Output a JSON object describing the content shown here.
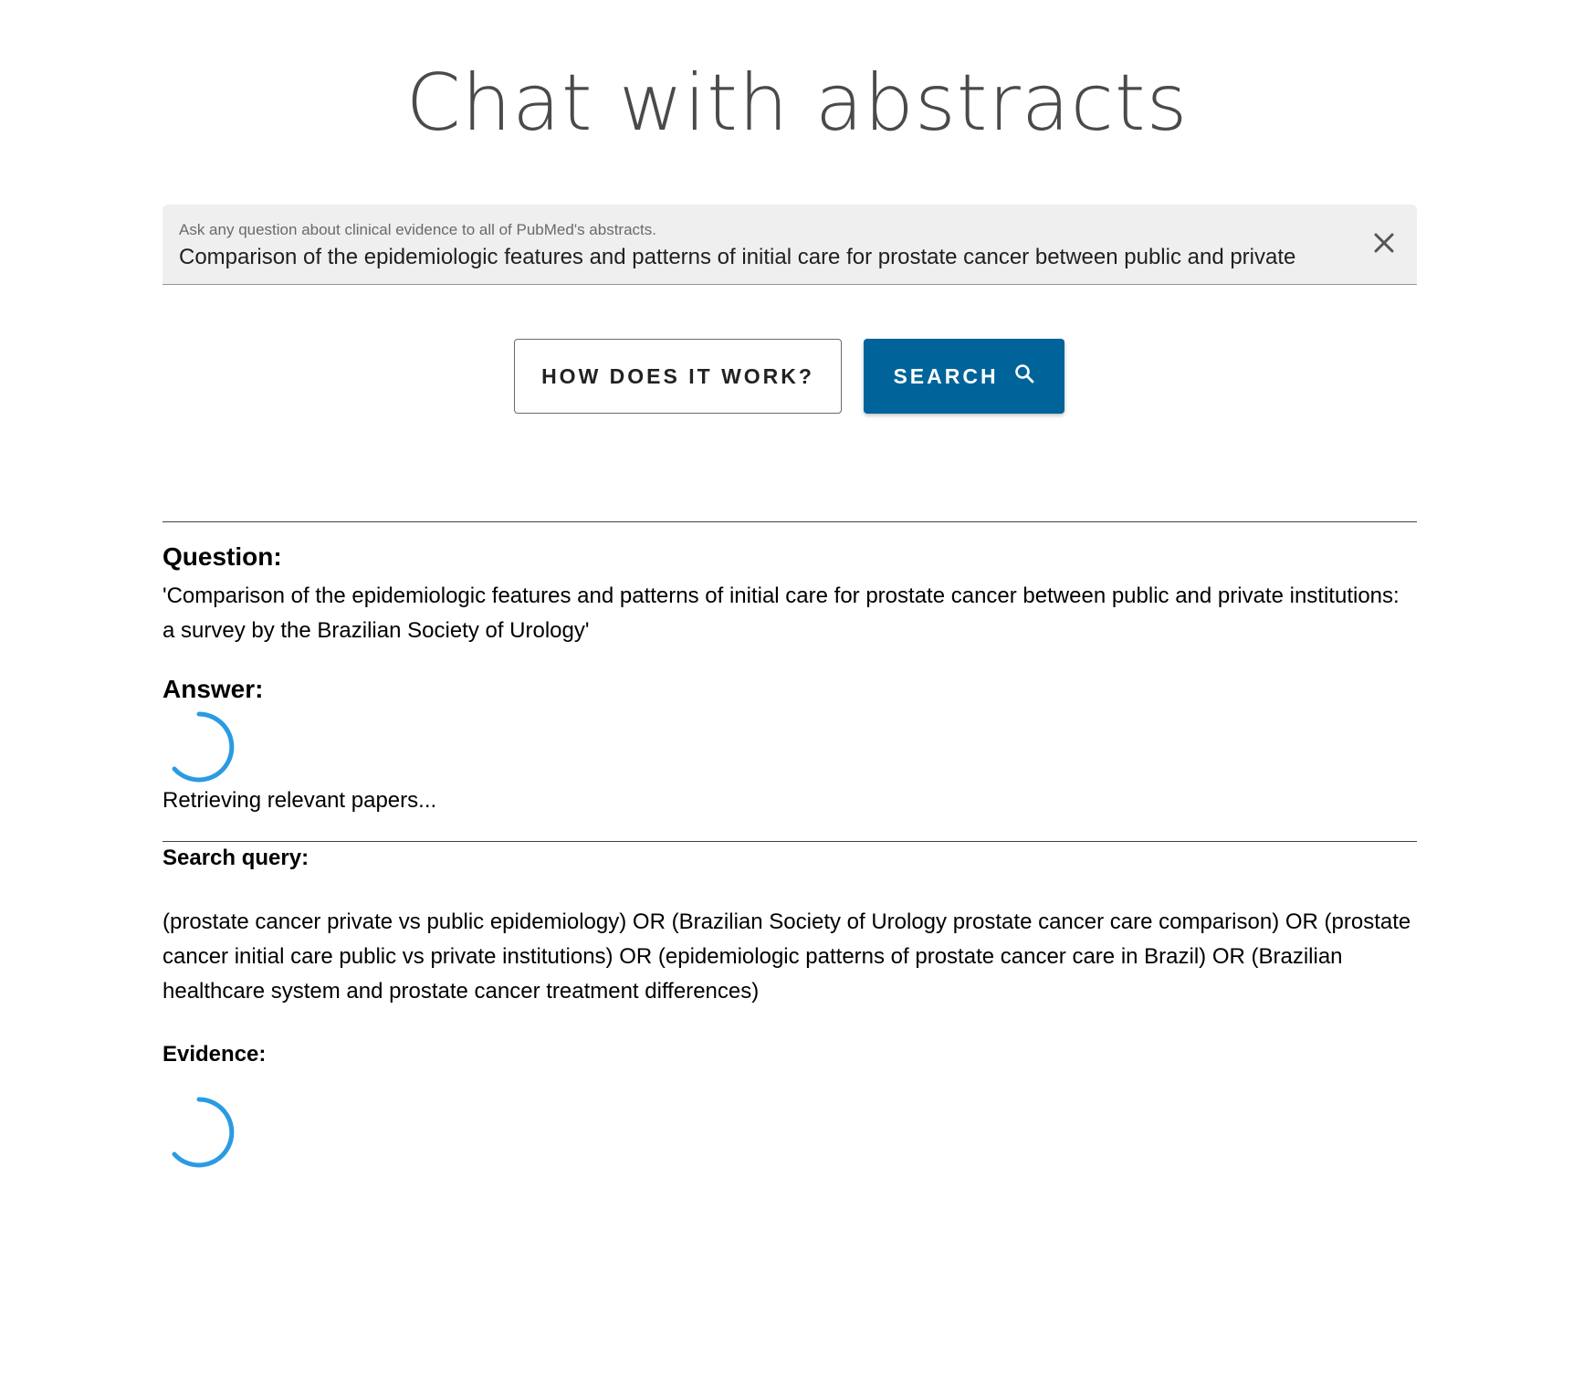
{
  "page": {
    "title": "Chat with abstracts"
  },
  "search": {
    "label": "Ask any question about clinical evidence to all of PubMed's abstracts.",
    "value": "Comparison of the epidemiologic features and patterns of initial care for prostate cancer between public and private"
  },
  "buttons": {
    "how_label": "HOW DOES IT WORK?",
    "search_label": "SEARCH"
  },
  "question": {
    "heading": "Question:",
    "text": "'Comparison of the epidemiologic features and patterns of initial care for prostate cancer between public and private institutions: a survey by the Brazilian Society of Urology'"
  },
  "answer": {
    "heading": "Answer:",
    "status": "Retrieving relevant papers..."
  },
  "search_query": {
    "heading": "Search query:",
    "text": "(prostate cancer private vs public epidemiology) OR (Brazilian Society of Urology prostate cancer care comparison) OR (prostate cancer initial care public vs private institutions) OR (epidemiologic patterns of prostate cancer care in Brazil) OR (Brazilian healthcare system and prostate cancer treatment differences)"
  },
  "evidence": {
    "heading": "Evidence:"
  },
  "icons": {
    "clear": "close-icon",
    "search": "search-icon",
    "spinner": "loading-spinner-icon"
  },
  "colors": {
    "accent": "#00639a",
    "spinner": "#2a9be3",
    "title": "#4a4a4a"
  }
}
